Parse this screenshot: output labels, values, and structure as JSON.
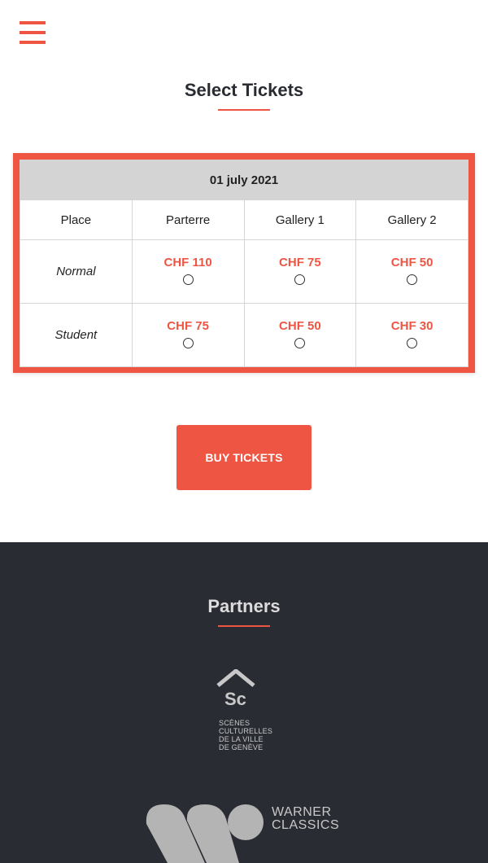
{
  "header": {
    "menu_icon": "hamburger-menu-icon"
  },
  "tickets": {
    "title": "Select Tickets",
    "date": "01 july 2021",
    "columns": [
      "Place",
      "Parterre",
      "Gallery 1",
      "Gallery 2"
    ],
    "rows": [
      {
        "label": "Normal",
        "prices": [
          "CHF 110",
          "CHF 75",
          "CHF 50"
        ]
      },
      {
        "label": "Student",
        "prices": [
          "CHF 75",
          "CHF 50",
          "CHF 30"
        ]
      }
    ]
  },
  "buy_button": {
    "label": "BUY TICKETS"
  },
  "partners": {
    "title": "Partners",
    "scenes_culturelles": {
      "logo_letters": "Sc",
      "lines": [
        "SCÈNES",
        "CULTURELLES",
        "DE LA VILLE",
        "DE GENÈVE"
      ]
    },
    "warner_classics": {
      "lines": [
        "WARNER",
        "CLASSICS"
      ]
    }
  },
  "colors": {
    "accent": "#ee5543",
    "footer_bg": "#2a2c33",
    "date_bg": "#d4d4d4"
  }
}
